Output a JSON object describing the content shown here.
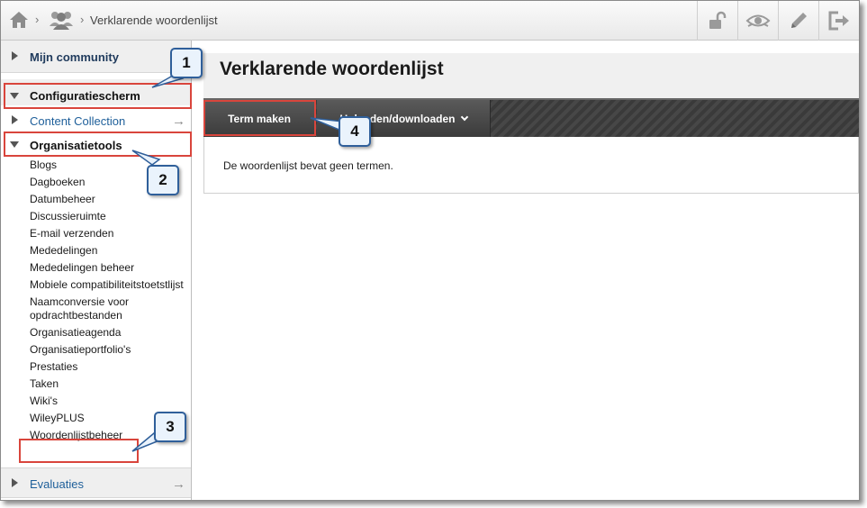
{
  "breadcrumb": {
    "home_icon": "home-icon",
    "group_icon": "users-group-icon",
    "separator": "›",
    "current": "Verklarende woordenlijst"
  },
  "toolbar": {
    "icons": [
      "unlock-icon",
      "eye-icon",
      "pencil-icon",
      "logout-icon"
    ]
  },
  "sidebar": {
    "mijn_community": "Mijn community",
    "configuratiescherm": "Configuratiescherm",
    "content_collection": "Content Collection",
    "organisatietools": "Organisatietools",
    "tools": [
      "Blogs",
      "Dagboeken",
      "Datumbeheer",
      "Discussieruimte",
      "E-mail verzenden",
      "Mededelingen",
      "Mededelingen beheer",
      "Mobiele compatibiliteitstoetstlijst",
      "Naamconversie voor opdrachtbestanden",
      "Organisatieagenda",
      "Organisatieportfolio's",
      "Prestaties",
      "Taken",
      "Wiki's",
      "WileyPLUS",
      "Woordenlijstbeheer"
    ],
    "evaluaties": "Evaluaties",
    "arrow": "→"
  },
  "main": {
    "title": "Verklarende woordenlijst",
    "term_button": "Term maken",
    "upload_button": "Uploaden/downloaden",
    "empty_message": "De woordenlijst bevat geen termen."
  },
  "callouts": [
    "1",
    "2",
    "3",
    "4"
  ],
  "colors": {
    "highlight": "#d9453c",
    "callout_border": "#2f5f9a",
    "callout_fill": "#eaf3fc",
    "action_bar": "#3a3a3a",
    "link": "#1e5f9a"
  }
}
